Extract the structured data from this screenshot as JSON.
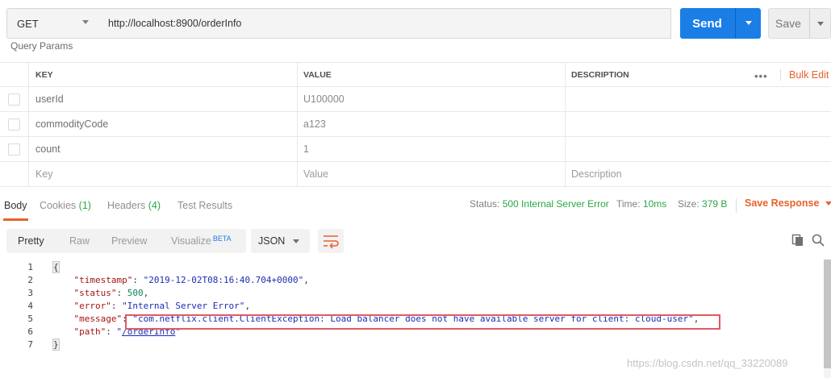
{
  "request": {
    "method": "GET",
    "url": "http://localhost:8900/orderInfo",
    "send_label": "Send",
    "save_label": "Save"
  },
  "params": {
    "section_title": "Query Params",
    "headers": [
      "KEY",
      "VALUE",
      "DESCRIPTION"
    ],
    "bulk_edit_label": "Bulk Edit",
    "rows": [
      {
        "key": "userId",
        "value": "U100000",
        "description": ""
      },
      {
        "key": "commodityCode",
        "value": "a123",
        "description": ""
      },
      {
        "key": "count",
        "value": "1",
        "description": ""
      }
    ],
    "placeholder": {
      "key": "Key",
      "value": "Value",
      "description": "Description"
    }
  },
  "response_tabs": {
    "body": "Body",
    "cookies": "Cookies",
    "cookies_count": "(1)",
    "headers": "Headers",
    "headers_count": "(4)",
    "test_results": "Test Results"
  },
  "status": {
    "status_label": "Status:",
    "status_value": "500 Internal Server Error",
    "time_label": "Time:",
    "time_value": "10ms",
    "size_label": "Size:",
    "size_value": "379 B",
    "save_response_label": "Save Response"
  },
  "view_toolbar": {
    "pretty": "Pretty",
    "raw": "Raw",
    "preview": "Preview",
    "visualize": "Visualize",
    "beta": "BETA",
    "format": "JSON"
  },
  "body_lines": {
    "timestamp_key": "\"timestamp\"",
    "timestamp_value": "\"2019-12-02T08:16:40.704+0000\"",
    "status_key": "\"status\"",
    "status_value": "500",
    "error_key": "\"error\"",
    "error_value": "\"Internal Server Error\"",
    "message_key": "\"message\"",
    "message_value": "\"com.netflix.client.ClientException: Load balancer does not have available server for client: cloud-user\"",
    "path_key": "\"path\"",
    "path_quote_open": "\"",
    "path_value": "/orderInfo",
    "path_quote_close": "\""
  },
  "watermark": "https://blog.csdn.net/qq_33220089",
  "colors": {
    "accent": "#e8622c",
    "send_blue": "#1b7ee6",
    "status_green": "#2aa745",
    "highlight_red": "#e05a63"
  }
}
